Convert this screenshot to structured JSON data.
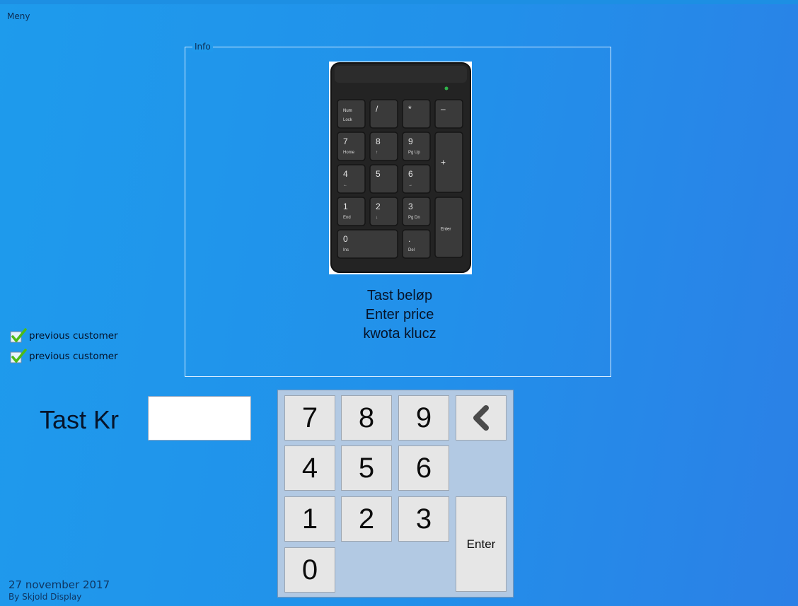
{
  "window": {
    "menu_label": "Meny"
  },
  "info": {
    "legend": "Info",
    "lines": [
      "Tast beløp",
      "Enter price",
      "kwota klucz"
    ],
    "photo": {
      "keys": [
        {
          "main": "Num",
          "sub": "Lock"
        },
        {
          "main": "/",
          "sub": ""
        },
        {
          "main": "*",
          "sub": ""
        },
        {
          "main": "–",
          "sub": ""
        },
        {
          "main": "7",
          "sub": "Home"
        },
        {
          "main": "8",
          "sub": "↑"
        },
        {
          "main": "9",
          "sub": "Pg Up"
        },
        {
          "main": "+",
          "sub": ""
        },
        {
          "main": "4",
          "sub": "←"
        },
        {
          "main": "5",
          "sub": ""
        },
        {
          "main": "6",
          "sub": "→"
        },
        {
          "main": "1",
          "sub": "End"
        },
        {
          "main": "2",
          "sub": "↓"
        },
        {
          "main": "3",
          "sub": "Pg Dn"
        },
        {
          "main": "Enter",
          "sub": ""
        },
        {
          "main": "0",
          "sub": "Ins"
        },
        {
          "main": ".",
          "sub": "Del"
        }
      ]
    }
  },
  "checks": [
    {
      "label": "previous customer"
    },
    {
      "label": "previous customer"
    }
  ],
  "amount": {
    "label": "Tast Kr",
    "value": "",
    "placeholder": ""
  },
  "numpad": {
    "keys": {
      "k7": "7",
      "k8": "8",
      "k9": "9",
      "k4": "4",
      "k5": "5",
      "k6": "6",
      "k1": "1",
      "k2": "2",
      "k3": "3",
      "k0": "0",
      "enter": "Enter"
    },
    "backspace_icon": "chevron-left-icon"
  },
  "footer": {
    "date": "27 november 2017",
    "by": "By Skjold Display"
  },
  "colors": {
    "background": "#2290ea",
    "check_green": "#4cbb17",
    "numpad_bg": "#b2c9e3",
    "key_bg": "#e6e6e6"
  }
}
